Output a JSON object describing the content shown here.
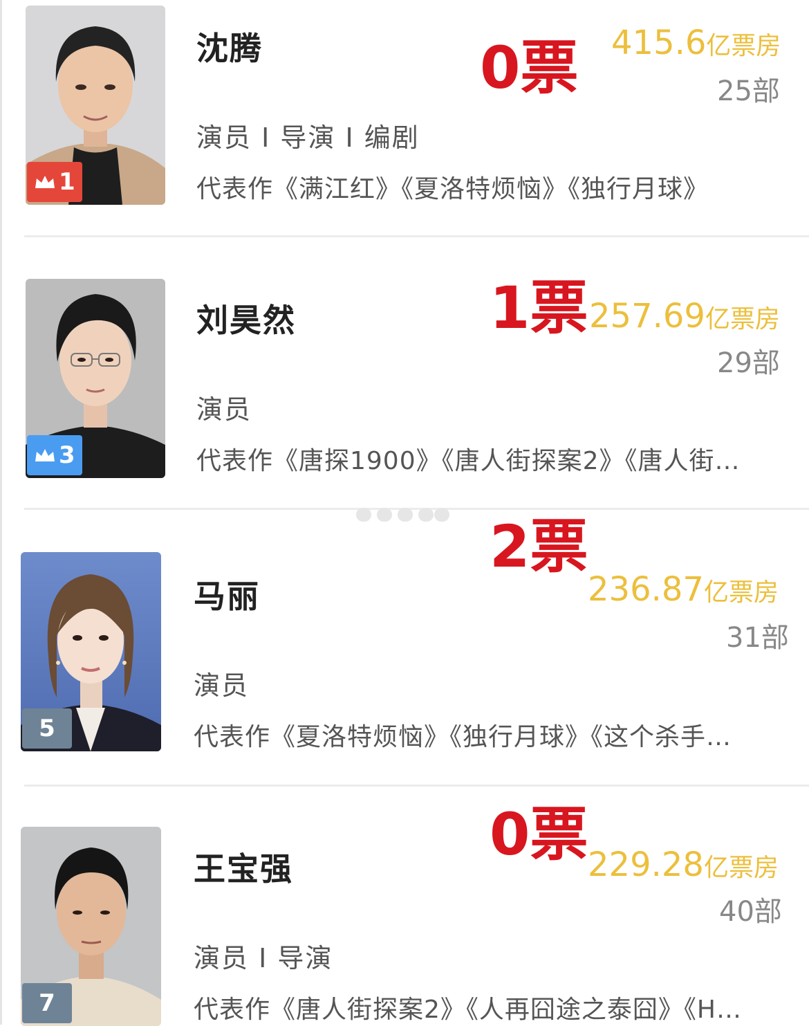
{
  "rankings": [
    {
      "rank": "1",
      "name": "沈腾",
      "roles": "演员 I 导演 I 编剧",
      "works": "代表作《满江红》《夏洛特烦恼》《独行月球》",
      "votes": "0票",
      "box_office_value": "415.6",
      "box_office_unit": "亿票房",
      "film_count": "25部",
      "badge_color": "#e4473a",
      "has_crown": true
    },
    {
      "rank": "3",
      "name": "刘昊然",
      "roles": "演员",
      "works": "代表作《唐探1900》《唐人街探案2》《唐人街…",
      "votes": "1票",
      "box_office_value": "257.69",
      "box_office_unit": "亿票房",
      "film_count": "29部",
      "badge_color": "#4a9cf0",
      "has_crown": true
    },
    {
      "rank": "5",
      "name": "马丽",
      "roles": "演员",
      "works": "代表作《夏洛特烦恼》《独行月球》《这个杀手…",
      "votes": "2票",
      "box_office_value": "236.87",
      "box_office_unit": "亿票房",
      "film_count": "31部",
      "badge_color": "#6f8396",
      "has_crown": false
    },
    {
      "rank": "7",
      "name": "王宝强",
      "roles": "演员 I 导演",
      "works": "代表作《唐人街探案2》《人再囧途之泰囧》《H…",
      "votes": "0票",
      "box_office_value": "229.28",
      "box_office_unit": "亿票房",
      "film_count": "40部",
      "badge_color": "#6f8396",
      "has_crown": false
    }
  ],
  "colors": {
    "votes": "#d8161f",
    "box_office": "#ecbf3c",
    "film_count": "#888888"
  }
}
